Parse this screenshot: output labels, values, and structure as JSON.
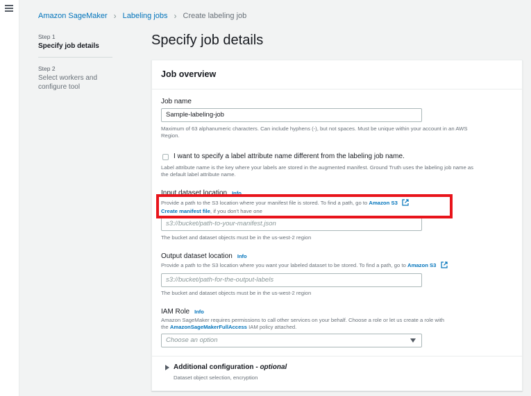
{
  "breadcrumb": {
    "items": [
      "Amazon SageMaker",
      "Labeling jobs"
    ],
    "current": "Create labeling job"
  },
  "steps": [
    {
      "number": "Step 1",
      "title": "Specify job details"
    },
    {
      "number": "Step 2",
      "title": "Select workers and configure tool"
    }
  ],
  "page_title": "Specify job details",
  "panel": {
    "title": "Job overview",
    "job_name": {
      "label": "Job name",
      "value": "Sample-labeling-job",
      "hint_line1": "Maximum of 63 alphanumeric characters. Can include hyphens (-), but not spaces. Must be unique within your account in an AWS",
      "hint_line2": "Region."
    },
    "label_attr": {
      "checkbox_label": "I want to specify a label attribute name different from the labeling job name.",
      "hint_line1": "Label attribute name is the key where your labels are stored in the augmented manifest. Ground Truth uses the labeling job name as",
      "hint_line2": "the default label attribute name."
    },
    "input_dataset": {
      "label": "Input dataset location",
      "info": "Info",
      "desc_prefix": "Provide a path to the S3 location where your manifest file is stored. To find a path, go to",
      "desc_link": "Amazon S3",
      "manifest_link": "Create manifest file",
      "manifest_suffix": ", if you don't have one",
      "placeholder": "s3://bucket/path-to-your-manifest.json",
      "hint": "The bucket and dataset objects must be in the us-west-2 region"
    },
    "output_dataset": {
      "label": "Output dataset location",
      "info": "Info",
      "desc_prefix": "Provide a path to the S3 location where you want your labeled dataset to be stored. To find a path, go to",
      "desc_link": "Amazon S3",
      "placeholder": "s3://bucket/path-for-the-output-labels",
      "hint": "The bucket and dataset objects must be in the us-west-2 region"
    },
    "iam_role": {
      "label": "IAM Role",
      "info": "Info",
      "desc_line1": "Amazon SageMaker requires permissions to call other services on your behalf. Choose a role or let us create a role with",
      "desc_line2_prefix": "the",
      "desc_link": "AmazonSageMakerFullAccess",
      "desc_line2_suffix": "IAM policy attached.",
      "placeholder": "Choose an option"
    },
    "additional": {
      "title": "Additional configuration -",
      "optional": "optional",
      "desc": "Dataset object selection, encryption"
    }
  },
  "colors": {
    "accent": "#0073bb",
    "highlight": "#e8141b"
  },
  "icons": [
    "menu-icon",
    "chevron-right-icon",
    "external-link-icon",
    "caret-down-icon",
    "caret-right-icon"
  ]
}
